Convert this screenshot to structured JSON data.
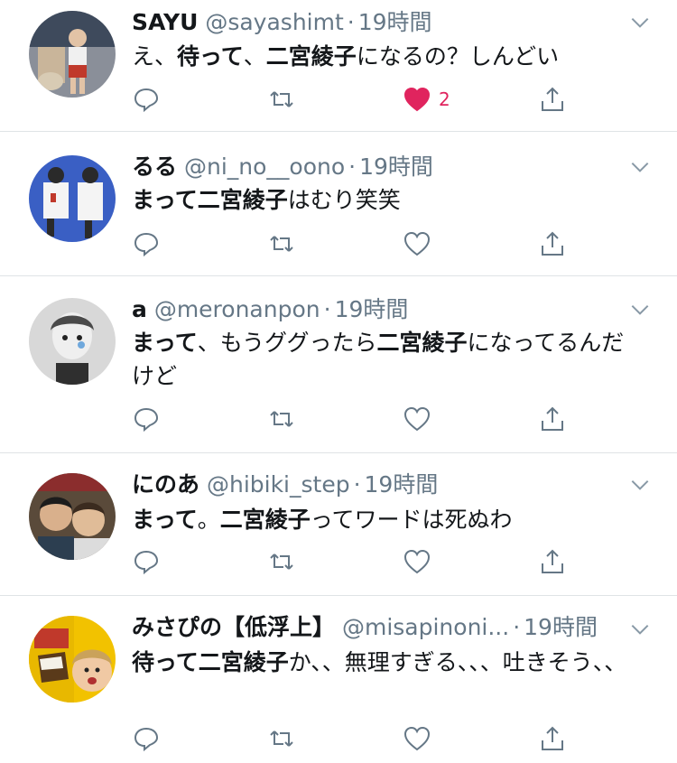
{
  "tweets": [
    {
      "name": "SAYU",
      "handle": "@sayashimt",
      "dot": "·",
      "time": "19時間",
      "body": [
        {
          "text": "え、",
          "bold": false
        },
        {
          "text": "待って",
          "bold": true
        },
        {
          "text": "、",
          "bold": false
        },
        {
          "text": "二宮綾子",
          "bold": true
        },
        {
          "text": "になるの？しんどい",
          "bold": false
        }
      ],
      "liked": true,
      "like_count": "2"
    },
    {
      "name": "るる",
      "handle": "@ni_no__oono",
      "dot": "·",
      "time": "19時間",
      "body": [
        {
          "text": "まって二宮綾子",
          "bold": true
        },
        {
          "text": "はむり笑笑",
          "bold": false
        }
      ],
      "liked": false,
      "like_count": ""
    },
    {
      "name": "a",
      "handle": "@meronanpon",
      "dot": "·",
      "time": "19時間",
      "body": [
        {
          "text": "まって",
          "bold": true
        },
        {
          "text": "、もうググったら",
          "bold": false
        },
        {
          "text": "二宮綾子",
          "bold": true
        },
        {
          "text": "になってるんだけど",
          "bold": false
        }
      ],
      "liked": false,
      "like_count": ""
    },
    {
      "name": "にのあ",
      "handle": "@hibiki_step",
      "dot": "·",
      "time": "19時間",
      "body": [
        {
          "text": "まって",
          "bold": true
        },
        {
          "text": "。",
          "bold": false
        },
        {
          "text": "二宮綾子",
          "bold": true
        },
        {
          "text": "ってワードは死ぬわ",
          "bold": false
        }
      ],
      "liked": false,
      "like_count": ""
    },
    {
      "name": "みさぴの【低浮上】",
      "handle": "@misapinoni...",
      "dot": "·",
      "time": "19時間",
      "body": [
        {
          "text": "待って二宮綾子",
          "bold": true
        },
        {
          "text": "か、、無理すぎる、、、吐きそう、、",
          "bold": false
        }
      ],
      "liked": false,
      "like_count": ""
    }
  ],
  "colors": {
    "like_active": "#e0245e",
    "icon_gray": "#657786",
    "divider": "#dfe3e6"
  },
  "icons": [
    "reply-icon",
    "retweet-icon",
    "like-icon",
    "share-icon",
    "chevron-down-icon"
  ]
}
